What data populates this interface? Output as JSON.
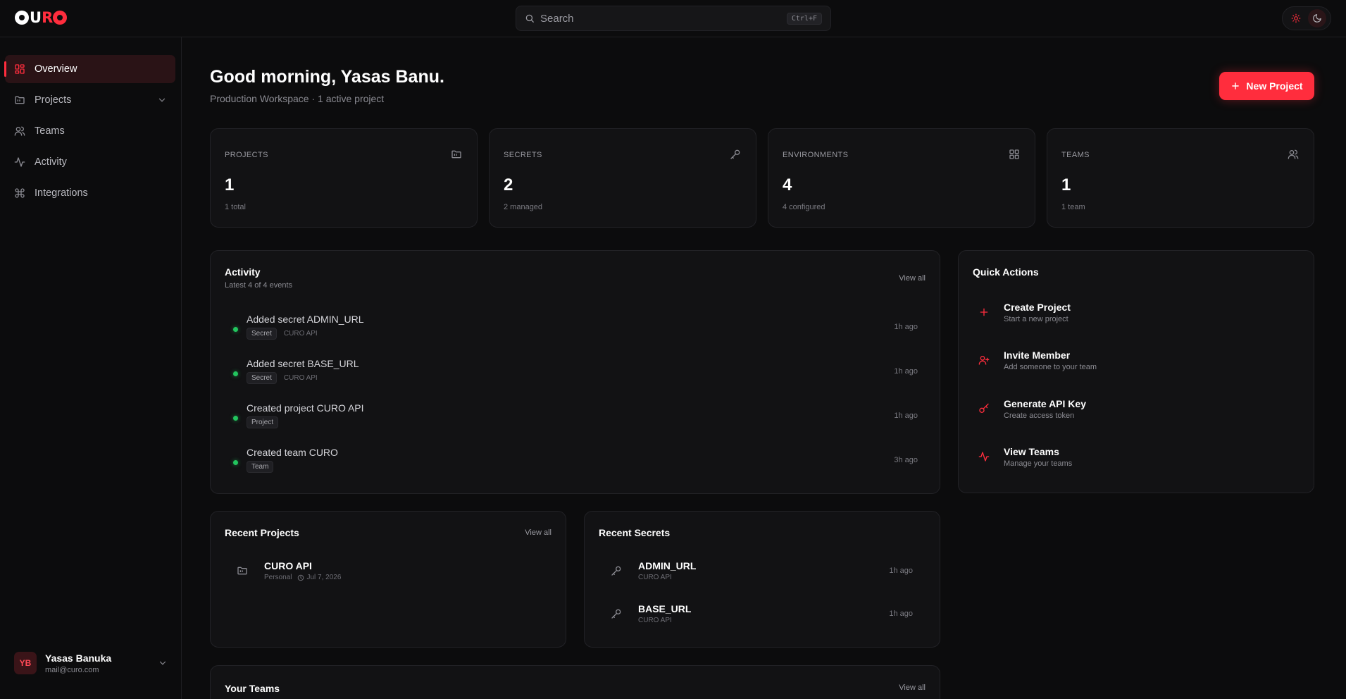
{
  "app": {
    "logo": "OURO",
    "accent": "#ff2d3d"
  },
  "search": {
    "placeholder": "Search",
    "shortcut": "Ctrl+F"
  },
  "sidebar": {
    "items": [
      {
        "label": "Overview",
        "icon": "grid-icon",
        "active": true
      },
      {
        "label": "Projects",
        "icon": "folder-icon",
        "has_chevron": true
      },
      {
        "label": "Teams",
        "icon": "users-icon"
      },
      {
        "label": "Activity",
        "icon": "activity-icon"
      },
      {
        "label": "Integrations",
        "icon": "command-icon"
      }
    ],
    "user": {
      "initials": "YB",
      "name": "Yasas Banuka",
      "email": "mail@curo.com"
    }
  },
  "header": {
    "greeting": "Good morning, Yasas Banu.",
    "subtitle": "Production Workspace · 1 active project",
    "new_project_label": "New Project"
  },
  "stats": [
    {
      "label": "PROJECTS",
      "value": "1",
      "note": "1 total",
      "icon": "folder-icon"
    },
    {
      "label": "SECRETS",
      "value": "2",
      "note": "2 managed",
      "icon": "key-icon"
    },
    {
      "label": "ENVIRONMENTS",
      "value": "4",
      "note": "4 configured",
      "icon": "grid-icon"
    },
    {
      "label": "TEAMS",
      "value": "1",
      "note": "1 team",
      "icon": "users-icon"
    }
  ],
  "activity": {
    "title": "Activity",
    "subtitle": "Latest 4 of 4 events",
    "view_all": "View all",
    "events": [
      {
        "text": "Added secret ADMIN_URL",
        "tag": "Secret",
        "project": "CURO API",
        "time": "1h ago"
      },
      {
        "text": "Added secret BASE_URL",
        "tag": "Secret",
        "project": "CURO API",
        "time": "1h ago"
      },
      {
        "text": "Created project CURO API",
        "tag": "Project",
        "project": "",
        "time": "1h ago"
      },
      {
        "text": "Created team CURO",
        "tag": "Team",
        "project": "",
        "time": "3h ago"
      }
    ]
  },
  "quick_actions": {
    "title": "Quick Actions",
    "items": [
      {
        "title": "Create Project",
        "subtitle": "Start a new project",
        "icon": "plus-icon"
      },
      {
        "title": "Invite Member",
        "subtitle": "Add someone to your team",
        "icon": "user-plus-icon"
      },
      {
        "title": "Generate API Key",
        "subtitle": "Create access token",
        "icon": "key-icon"
      },
      {
        "title": "View Teams",
        "subtitle": "Manage your teams",
        "icon": "activity-icon"
      }
    ]
  },
  "recent_projects": {
    "title": "Recent Projects",
    "view_all": "View all",
    "items": [
      {
        "name": "CURO API",
        "scope": "Personal",
        "date": "Jul 7, 2026"
      }
    ]
  },
  "recent_secrets": {
    "title": "Recent Secrets",
    "items": [
      {
        "name": "ADMIN_URL",
        "project": "CURO API",
        "time": "1h ago"
      },
      {
        "name": "BASE_URL",
        "project": "CURO API",
        "time": "1h ago"
      }
    ]
  },
  "teams": {
    "title": "Your Teams",
    "view_all": "View all"
  }
}
